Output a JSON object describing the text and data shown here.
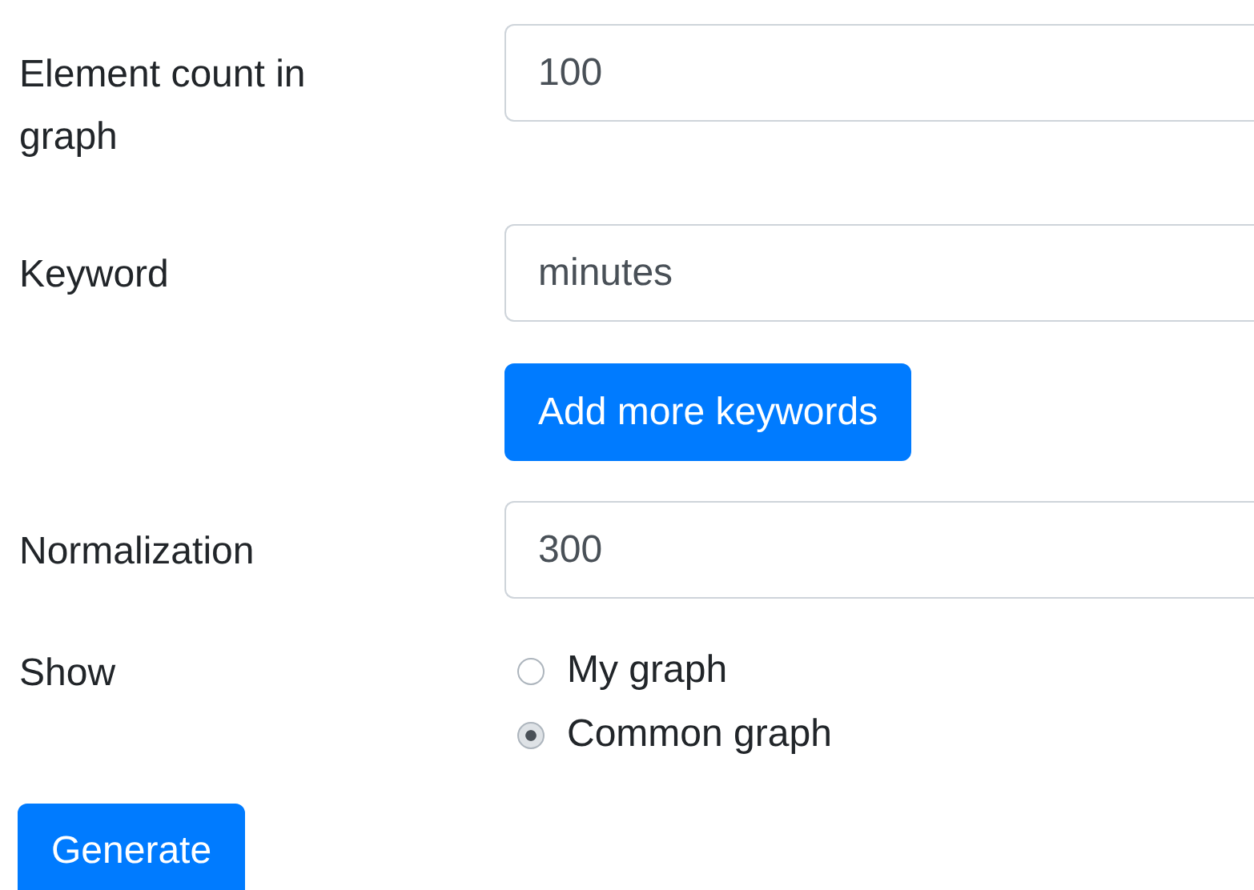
{
  "fields": [
    {
      "kind": "input",
      "label": "Element count in graph",
      "value": "100"
    },
    {
      "kind": "input",
      "label": "Keyword",
      "value": "minutes"
    },
    {
      "kind": "button",
      "label": "Add more keywords"
    },
    {
      "kind": "input",
      "label": "Normalization",
      "value": "300"
    },
    {
      "kind": "radio",
      "label": "Show",
      "options": [
        {
          "label": "My graph",
          "selected": false
        },
        {
          "label": "Common graph",
          "selected": true
        }
      ]
    }
  ],
  "submit": "Generate"
}
